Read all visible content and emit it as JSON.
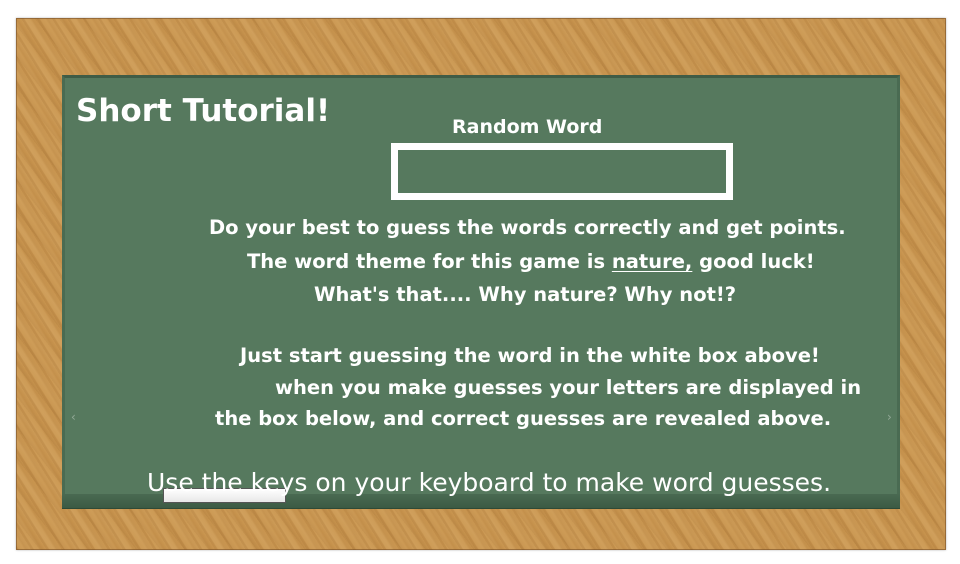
{
  "tutorial": {
    "title": "Short Tutorial!",
    "random_word_label": "Random Word",
    "random_word_value": "",
    "lines": [
      "Do your best to guess the words correctly and get points.",
      "The word theme for this game is ",
      "nature,",
      " good luck!",
      "What's that.... Why nature? Why not!?",
      "Just start guessing the word in the white box above!",
      "when you make guesses your letters are displayed in",
      "the box below, and correct guesses are revealed above."
    ],
    "keyboard_note": "Use the keys on your keyboard to make word guesses.",
    "guessed_letters": ""
  },
  "icons": {
    "prev": "chevron-left-icon",
    "next": "chevron-right-icon"
  },
  "colors": {
    "board": "#56795e",
    "frame": "#c8944e",
    "chalk": "#ffffff"
  }
}
